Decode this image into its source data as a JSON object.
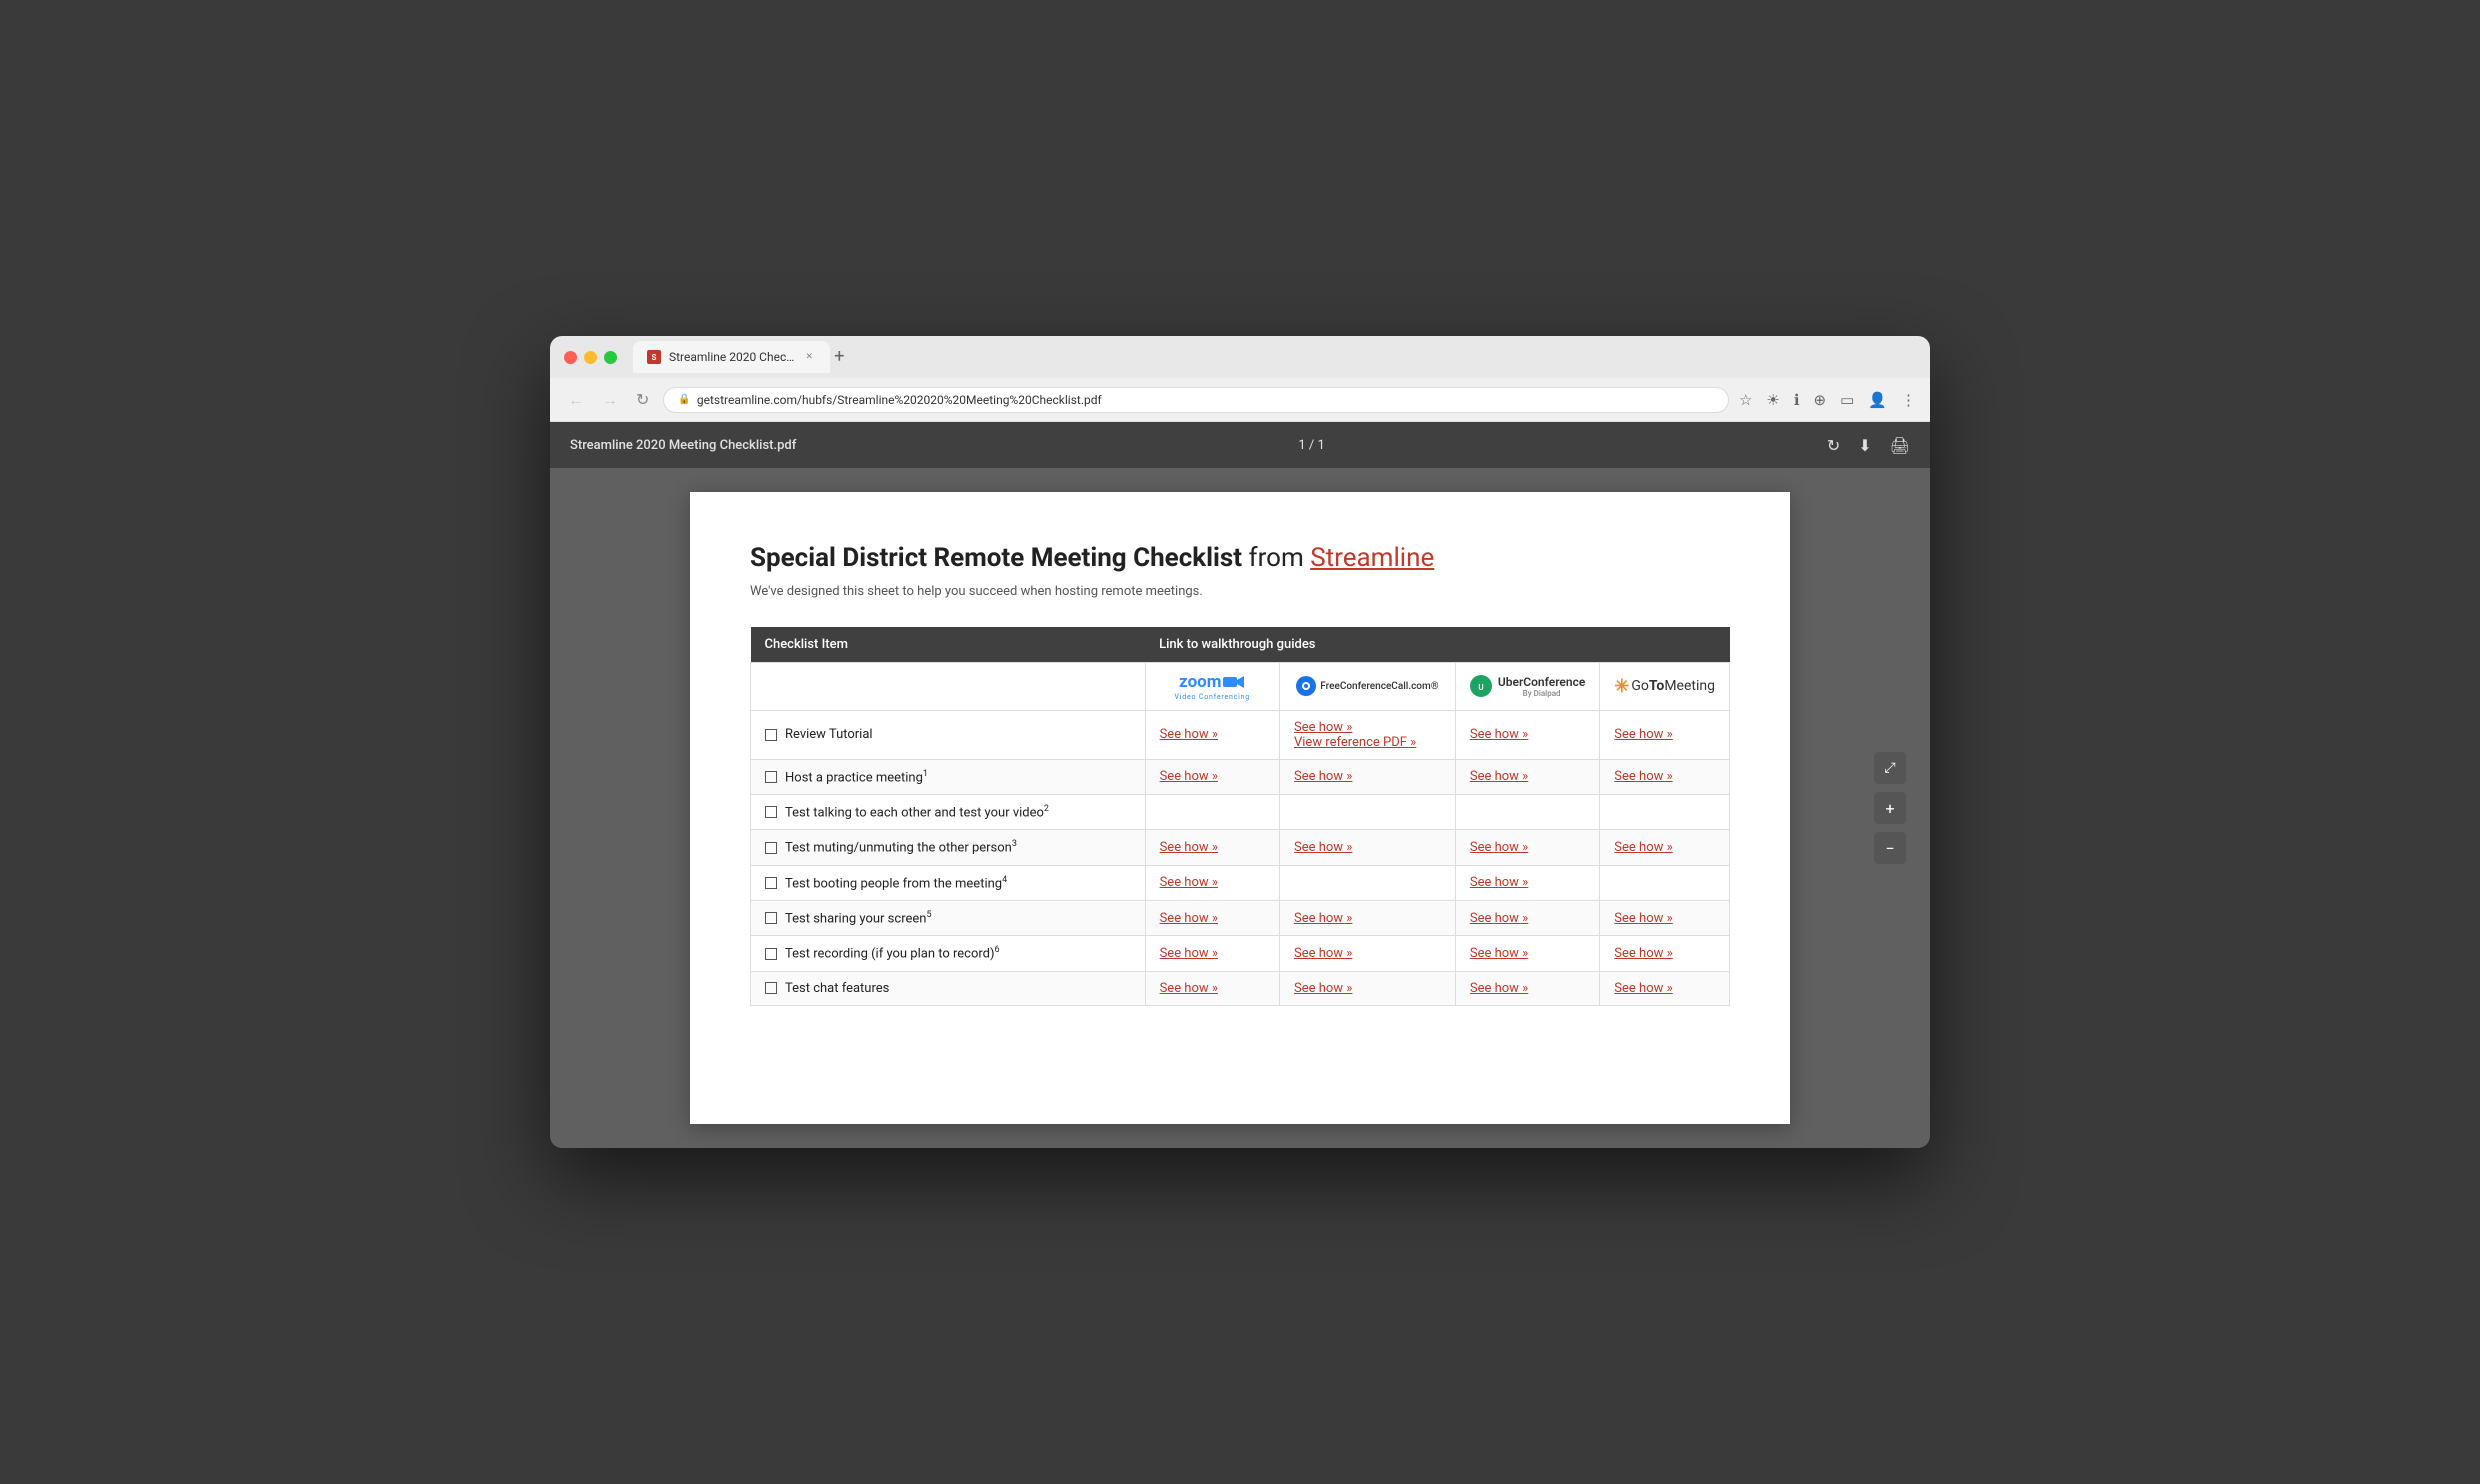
{
  "browser": {
    "tab_title": "Streamline 2020 Chec…",
    "tab_new_label": "+",
    "address": "getstreamline.com/hubfs/Streamline%202020%20Meeting%20Checklist.pdf",
    "pdf_filename": "Streamline 2020 Meeting Checklist.pdf",
    "page_indicator": "1 / 1"
  },
  "document": {
    "title_part1": "Special District Remote Meeting Checklist",
    "title_from": "from",
    "title_link": "Streamline",
    "subtitle": "We've designed this sheet to help you succeed when hosting remote meetings.",
    "table": {
      "col1_header": "Checklist Item",
      "col2_header": "Link to walkthrough guides",
      "providers": [
        "Zoom Video Conferencing",
        "FreeConferenceCall.com®",
        "UberConference By Dialpad",
        "GoToMeeting"
      ],
      "rows": [
        {
          "item": "Review Tutorial",
          "superscript": "",
          "zoom": "See how »",
          "fcc": "See how »\nView reference PDF »",
          "uber": "See how »",
          "goto": "See how »"
        },
        {
          "item": "Host a practice meeting",
          "superscript": "1",
          "zoom": "See how »",
          "fcc": "See how »",
          "uber": "See how »",
          "goto": "See how »"
        },
        {
          "item": "Test talking to each other and test your video",
          "superscript": "2",
          "zoom": "",
          "fcc": "",
          "uber": "",
          "goto": ""
        },
        {
          "item": "Test muting/unmuting the other person",
          "superscript": "3",
          "zoom": "See how »",
          "fcc": "See how »",
          "uber": "See how »",
          "goto": "See how »"
        },
        {
          "item": "Test booting people from the meeting",
          "superscript": "4",
          "zoom": "See how »",
          "fcc": "",
          "uber": "See how »",
          "goto": ""
        },
        {
          "item": "Test sharing your screen",
          "superscript": "5",
          "zoom": "See how »",
          "fcc": "See how »",
          "uber": "See how »",
          "goto": "See how »"
        },
        {
          "item": "Test recording (if you plan to record)",
          "superscript": "6",
          "zoom": "See how »",
          "fcc": "See how »",
          "uber": "See how »",
          "goto": "See how »"
        },
        {
          "item": "Test chat features",
          "superscript": "",
          "zoom": "See how »",
          "fcc": "See how »",
          "uber": "See how »",
          "goto": "See how »"
        }
      ]
    }
  },
  "zoom_controls": {
    "expand": "⤢",
    "plus": "+",
    "minus": "−"
  }
}
